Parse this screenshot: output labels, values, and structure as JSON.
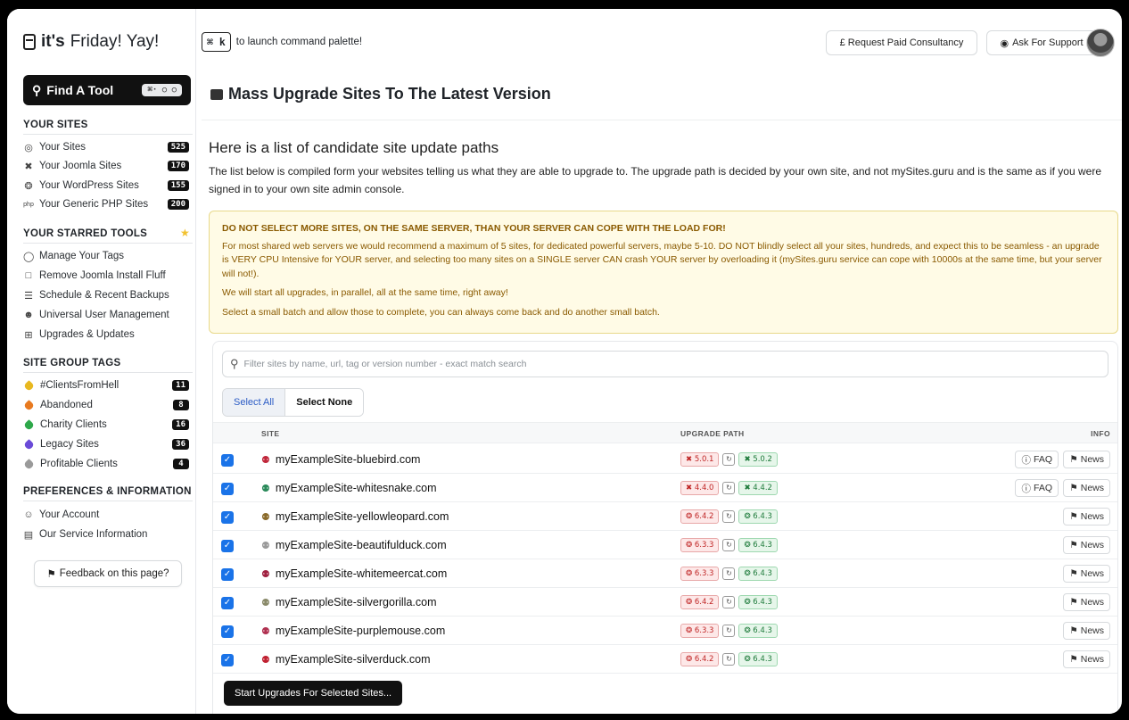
{
  "brand": {
    "prefix": "it's",
    "suffix": "Friday! Yay!"
  },
  "find_tool": {
    "label": "Find A Tool",
    "kbd": "⌘· ○ ○"
  },
  "sections": {
    "your_sites": "YOUR SITES",
    "starred_tools": "YOUR STARRED TOOLS",
    "group_tags": "SITE GROUP TAGS",
    "prefs": "PREFERENCES & INFORMATION"
  },
  "your_sites": [
    {
      "label": "Your Sites",
      "count": "525",
      "icon": "globe-icon"
    },
    {
      "label": "Your Joomla Sites",
      "count": "170",
      "icon": "joomla-icon"
    },
    {
      "label": "Your WordPress Sites",
      "count": "155",
      "icon": "wordpress-icon"
    },
    {
      "label": "Your Generic PHP Sites",
      "count": "200",
      "icon": "php-icon"
    }
  ],
  "starred_tools": [
    {
      "label": "Manage Your Tags",
      "icon": "tag-icon"
    },
    {
      "label": "Remove Joomla Install Fluff",
      "icon": "trash-icon"
    },
    {
      "label": "Schedule & Recent Backups",
      "icon": "database-icon"
    },
    {
      "label": "Universal User Management",
      "icon": "users-icon"
    },
    {
      "label": "Upgrades & Updates",
      "icon": "sitemap-icon"
    }
  ],
  "group_tags": [
    {
      "label": "#ClientsFromHell",
      "count": "11",
      "color": "#e8b820"
    },
    {
      "label": "Abandoned",
      "count": "8",
      "color": "#e87a20"
    },
    {
      "label": "Charity Clients",
      "count": "16",
      "color": "#2ea84a"
    },
    {
      "label": "Legacy Sites",
      "count": "36",
      "color": "#6a4bd8"
    },
    {
      "label": "Profitable Clients",
      "count": "4",
      "color": "#9a9a9a"
    }
  ],
  "prefs": [
    {
      "label": "Your Account",
      "icon": "user-icon"
    },
    {
      "label": "Our Service Information",
      "icon": "document-icon"
    }
  ],
  "feedback_label": "Feedback on this page?",
  "topbar": {
    "cmd_kbd": "⌘ k",
    "cmd_text": "to launch command palette!",
    "consultancy": "£ Request Paid Consultancy",
    "support": "Ask For Support"
  },
  "main": {
    "title": "Mass Upgrade Sites To The Latest Version",
    "subtitle": "Here is a list of candidate site update paths",
    "description": "The list below is compiled form your websites telling us what they are able to upgrade to. The upgrade path is decided by your own site, and not mySites.guru and is the same as if you were signed in to your own site admin console.",
    "warning_head": "DO NOT SELECT MORE SITES, ON THE SAME SERVER, THAN YOUR SERVER CAN COPE WITH THE LOAD FOR!",
    "warning_p1": "For most shared web servers we would recommend a maximum of 5 sites, for dedicated powerful servers, maybe 5-10. DO NOT blindly select all your sites, hundreds, and expect this to be seamless - an upgrade is VERY CPU Intensive for YOUR server, and selecting too many sites on a SINGLE server CAN crash YOUR server by overloading it (mySites.guru service can cope with 10000s at the same time, but your server will not!).",
    "warning_p2": "We will start all upgrades, in parallel, all at the same time, right away!",
    "warning_p3": "Select a small batch and allow those to complete, you can always come back and do another small batch.",
    "filter_placeholder": "Filter sites by name, url, tag or version number - exact match search",
    "select_all": "Select All",
    "select_none": "Select None",
    "col_site": "SITE",
    "col_upgrade": "UPGRADE PATH",
    "col_info": "INFO",
    "start_button": "Start Upgrades For Selected Sites..."
  },
  "rows": [
    {
      "site": "myExampleSite-bluebird.com",
      "from": "5.0.1",
      "to": "5.0.2",
      "cms": "joomla",
      "faq": "FAQ",
      "news": "News",
      "checked": true
    },
    {
      "site": "myExampleSite-whitesnake.com",
      "from": "4.4.0",
      "to": "4.4.2",
      "cms": "joomla",
      "faq": "FAQ",
      "news": "News",
      "checked": true
    },
    {
      "site": "myExampleSite-yellowleopard.com",
      "from": "6.4.2",
      "to": "6.4.3",
      "cms": "wordpress",
      "faq": "",
      "news": "News",
      "checked": true
    },
    {
      "site": "myExampleSite-beautifulduck.com",
      "from": "6.3.3",
      "to": "6.4.3",
      "cms": "wordpress",
      "faq": "",
      "news": "News",
      "checked": true
    },
    {
      "site": "myExampleSite-whitemeercat.com",
      "from": "6.3.3",
      "to": "6.4.3",
      "cms": "wordpress",
      "faq": "",
      "news": "News",
      "checked": true
    },
    {
      "site": "myExampleSite-silvergorilla.com",
      "from": "6.4.2",
      "to": "6.4.3",
      "cms": "wordpress",
      "faq": "",
      "news": "News",
      "checked": true
    },
    {
      "site": "myExampleSite-purplemouse.com",
      "from": "6.3.3",
      "to": "6.4.3",
      "cms": "wordpress",
      "faq": "",
      "news": "News",
      "checked": true
    },
    {
      "site": "myExampleSite-silverduck.com",
      "from": "6.4.2",
      "to": "6.4.3",
      "cms": "wordpress",
      "faq": "",
      "news": "News",
      "checked": true
    }
  ]
}
